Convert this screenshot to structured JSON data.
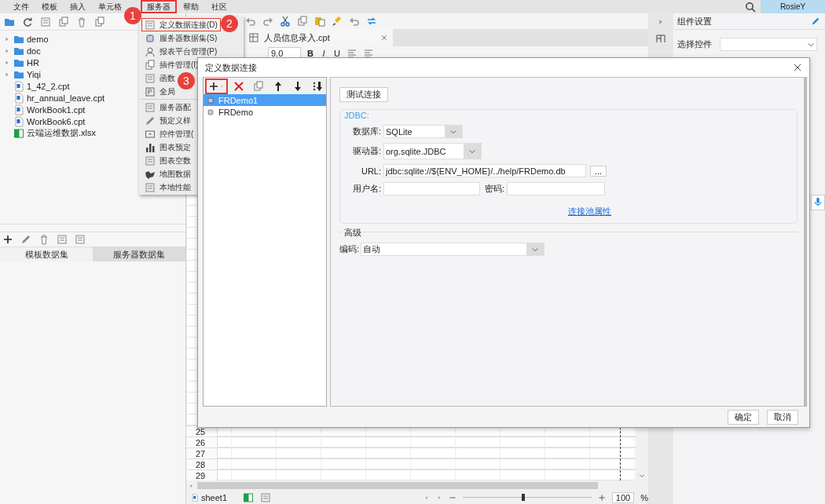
{
  "menubar": {
    "items": [
      {
        "label": "文件",
        "highlighted": false
      },
      {
        "label": "模板",
        "highlighted": false
      },
      {
        "label": "插入",
        "highlighted": false
      },
      {
        "label": "单元格",
        "highlighted": false
      },
      {
        "label": "服务器",
        "highlighted": true
      },
      {
        "label": "帮助",
        "highlighted": false
      },
      {
        "label": "社区",
        "highlighted": false
      }
    ],
    "user": "RosieY"
  },
  "left_panel": {
    "tree": [
      {
        "label": "demo",
        "kind": "folder"
      },
      {
        "label": "doc",
        "kind": "folder"
      },
      {
        "label": "HR",
        "kind": "folder"
      },
      {
        "label": "Yiqi",
        "kind": "folder"
      },
      {
        "label": "1_42_2.cpt",
        "kind": "report"
      },
      {
        "label": "hr_annual_leave.cpt",
        "kind": "report"
      },
      {
        "label": "WorkBook1.cpt",
        "kind": "report"
      },
      {
        "label": "WorkBook6.cpt",
        "kind": "report"
      },
      {
        "label": "云端运维数据.xlsx",
        "kind": "excel"
      }
    ],
    "tabs": [
      {
        "label": "模板数据集",
        "selected": true
      },
      {
        "label": "服务器数据集",
        "selected": false
      }
    ]
  },
  "server_menu": {
    "items": [
      {
        "label": "定义数据连接(D)",
        "highlighted": true
      },
      {
        "label": "服务器数据集(S)",
        "highlighted": false
      },
      {
        "label": "报表平台管理(P)",
        "highlighted": false
      },
      {
        "label": "插件管理(I)",
        "highlighted": false
      },
      {
        "label": "函数",
        "highlighted": false
      },
      {
        "label": "全局",
        "highlighted": false
      },
      {
        "label": "服务器配",
        "highlighted": false
      },
      {
        "label": "预定义样",
        "highlighted": false
      },
      {
        "label": "控件管理(",
        "highlighted": false
      },
      {
        "label": "图表预定",
        "highlighted": false
      },
      {
        "label": "图表空数",
        "highlighted": false
      },
      {
        "label": "地图数据",
        "highlighted": false
      },
      {
        "label": "本地性能",
        "highlighted": false
      }
    ]
  },
  "editor": {
    "file_tab": "人员信息录入.cpt",
    "font_size": "9.0",
    "format_buttons": [
      "B",
      "I",
      "U"
    ],
    "rows": [
      "25",
      "26",
      "27",
      "28",
      "29"
    ],
    "sheet_tab": "sheet1",
    "zoom_slider": {
      "level": 0.47
    },
    "zoom": "100",
    "zoom_unit": "%"
  },
  "right_panel": {
    "title": "组件设置",
    "select_label": "选择控件"
  },
  "dialog": {
    "title": "定义数据连接",
    "toolbar": [
      {
        "kind": "add",
        "highlighted": true
      },
      {
        "kind": "delete",
        "highlighted": false
      },
      {
        "kind": "copy",
        "highlighted": false
      },
      {
        "kind": "up",
        "highlighted": false
      },
      {
        "kind": "down",
        "highlighted": false
      },
      {
        "kind": "sort",
        "highlighted": false
      }
    ],
    "connections": [
      {
        "name": "FRDemo1",
        "selected": true
      },
      {
        "name": "FRDemo",
        "selected": false
      }
    ],
    "test_button": "测试连接",
    "group_title": "JDBC:",
    "fields": [
      {
        "label": "数据库:",
        "value": "SQLite",
        "kind": "select"
      },
      {
        "label": "驱动器:",
        "value": "org.sqlite.JDBC",
        "kind": "select"
      },
      {
        "label": "URL:",
        "value": "jdbc:sqlite://${ENV_HOME}/../help/FRDemo.db",
        "kind": "browse",
        "button": "..."
      }
    ],
    "credentials": [
      {
        "label": "用户名:"
      },
      {
        "label": "密码:"
      }
    ],
    "pool_link": "连接池属性",
    "advanced_title": "高级",
    "encoding": {
      "label": "编码:",
      "value": "自动"
    },
    "buttons": [
      "确定",
      "取消"
    ]
  },
  "annotations": [
    {
      "label": "1"
    },
    {
      "label": "2"
    },
    {
      "label": "3"
    }
  ]
}
